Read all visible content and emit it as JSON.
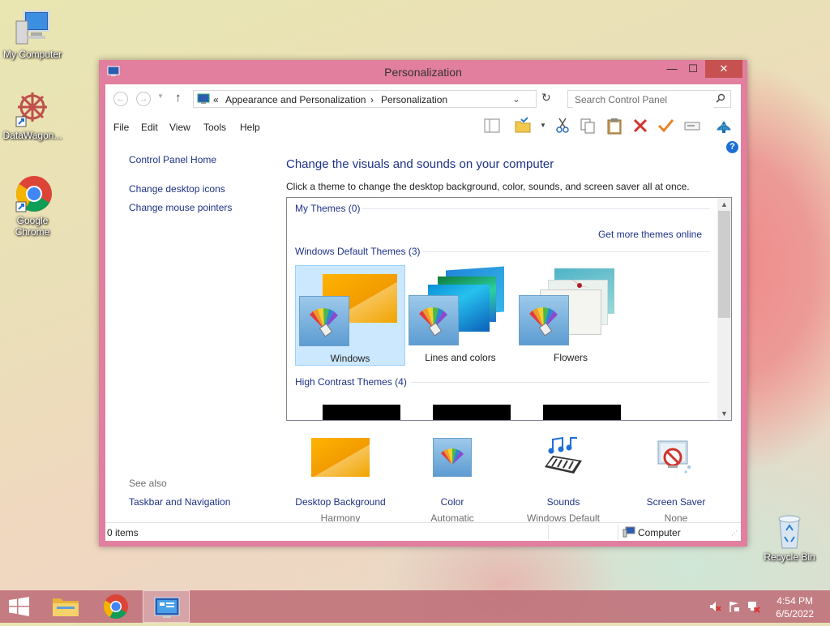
{
  "desktop": {
    "icons": [
      {
        "label": "My Computer"
      },
      {
        "label": "DataWagon..."
      },
      {
        "label": "Google Chrome"
      },
      {
        "label": "Recycle Bin"
      }
    ]
  },
  "window": {
    "title": "Personalization",
    "controls": {
      "minimize": "—",
      "maximize": "☐",
      "close": "✕"
    },
    "breadcrumb": {
      "sep_root": "«",
      "crumb1": "Appearance and Personalization",
      "sep": "›",
      "crumb2": "Personalization"
    },
    "search": {
      "placeholder": "Search Control Panel"
    },
    "menu": {
      "file": "File",
      "edit": "Edit",
      "view": "View",
      "tools": "Tools",
      "help": "Help"
    },
    "left_pane": {
      "home": "Control Panel Home",
      "desktop_icons": "Change desktop icons",
      "mouse_pointers": "Change mouse pointers",
      "see_also": "See also",
      "taskbar_nav": "Taskbar and Navigation"
    },
    "main": {
      "title": "Change the visuals and sounds on your computer",
      "description": "Click a theme to change the desktop background, color, sounds, and screen saver all at once.",
      "my_themes": "My Themes (0)",
      "get_more": "Get more themes online",
      "default_themes": "Windows Default Themes (3)",
      "themes": [
        {
          "name": "Windows"
        },
        {
          "name": "Lines and colors"
        },
        {
          "name": "Flowers"
        }
      ],
      "high_contrast": "High Contrast Themes (4)"
    },
    "bottom": [
      {
        "link": "Desktop Background",
        "value": "Harmony"
      },
      {
        "link": "Color",
        "value": "Automatic"
      },
      {
        "link": "Sounds",
        "value": "Windows Default"
      },
      {
        "link": "Screen Saver",
        "value": "None"
      }
    ],
    "status": {
      "items": "0 items",
      "location": "Computer"
    }
  },
  "taskbar": {
    "time": "4:54 PM",
    "date": "6/5/2022"
  },
  "colors": {
    "window_frame": "#e27e9e",
    "link": "#1e3287",
    "selection": "#cce8ff",
    "close_button": "#c75050"
  }
}
